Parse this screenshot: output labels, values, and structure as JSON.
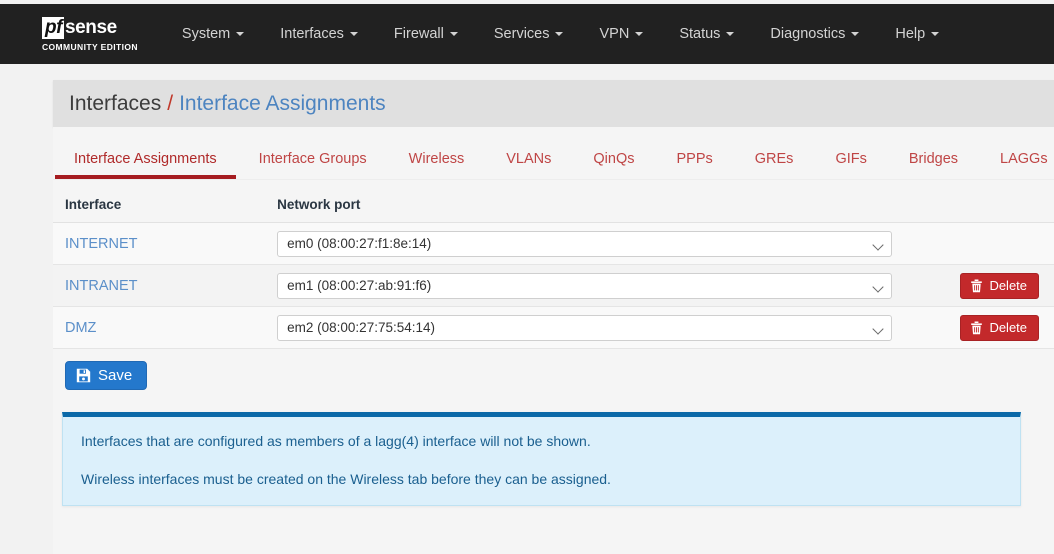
{
  "navbar": {
    "brand": {
      "pf": "pf",
      "sense": "sense",
      "edition": "COMMUNITY EDITION"
    },
    "items": [
      {
        "label": "System",
        "icon": "chevron-down-icon"
      },
      {
        "label": "Interfaces",
        "icon": "chevron-down-icon"
      },
      {
        "label": "Firewall",
        "icon": "chevron-down-icon"
      },
      {
        "label": "Services",
        "icon": "chevron-down-icon"
      },
      {
        "label": "VPN",
        "icon": "chevron-down-icon"
      },
      {
        "label": "Status",
        "icon": "chevron-down-icon"
      },
      {
        "label": "Diagnostics",
        "icon": "chevron-down-icon"
      },
      {
        "label": "Help",
        "icon": "chevron-down-icon"
      }
    ]
  },
  "breadcrumb": {
    "parent": "Interfaces",
    "separator": "/",
    "current": "Interface Assignments"
  },
  "tabs": [
    {
      "label": "Interface Assignments",
      "active": true
    },
    {
      "label": "Interface Groups",
      "active": false
    },
    {
      "label": "Wireless",
      "active": false
    },
    {
      "label": "VLANs",
      "active": false
    },
    {
      "label": "QinQs",
      "active": false
    },
    {
      "label": "PPPs",
      "active": false
    },
    {
      "label": "GREs",
      "active": false
    },
    {
      "label": "GIFs",
      "active": false
    },
    {
      "label": "Bridges",
      "active": false
    },
    {
      "label": "LAGGs",
      "active": false
    }
  ],
  "table": {
    "headers": {
      "interface": "Interface",
      "network_port": "Network port"
    },
    "rows": [
      {
        "interface": "INTERNET",
        "port": "em0 (08:00:27:f1:8e:14)",
        "has_delete": false,
        "delete_label": ""
      },
      {
        "interface": "INTRANET",
        "port": "em1 (08:00:27:ab:91:f6)",
        "has_delete": true,
        "delete_label": "Delete"
      },
      {
        "interface": "DMZ",
        "port": "em2 (08:00:27:75:54:14)",
        "has_delete": true,
        "delete_label": "Delete"
      }
    ]
  },
  "actions": {
    "save_label": "Save"
  },
  "info": {
    "line1": "Interfaces that are configured as members of a lagg(4) interface will not be shown.",
    "line2": "Wireless interfaces must be created on the Wireless tab before they can be assigned."
  },
  "colors": {
    "navbar_bg": "#212121",
    "accent_red": "#a51c20",
    "link_blue": "#5b8fc9",
    "save_blue": "#2478cc",
    "delete_red": "#c3292b",
    "info_bg": "#dcf0fb",
    "info_border": "#0b69a8"
  }
}
